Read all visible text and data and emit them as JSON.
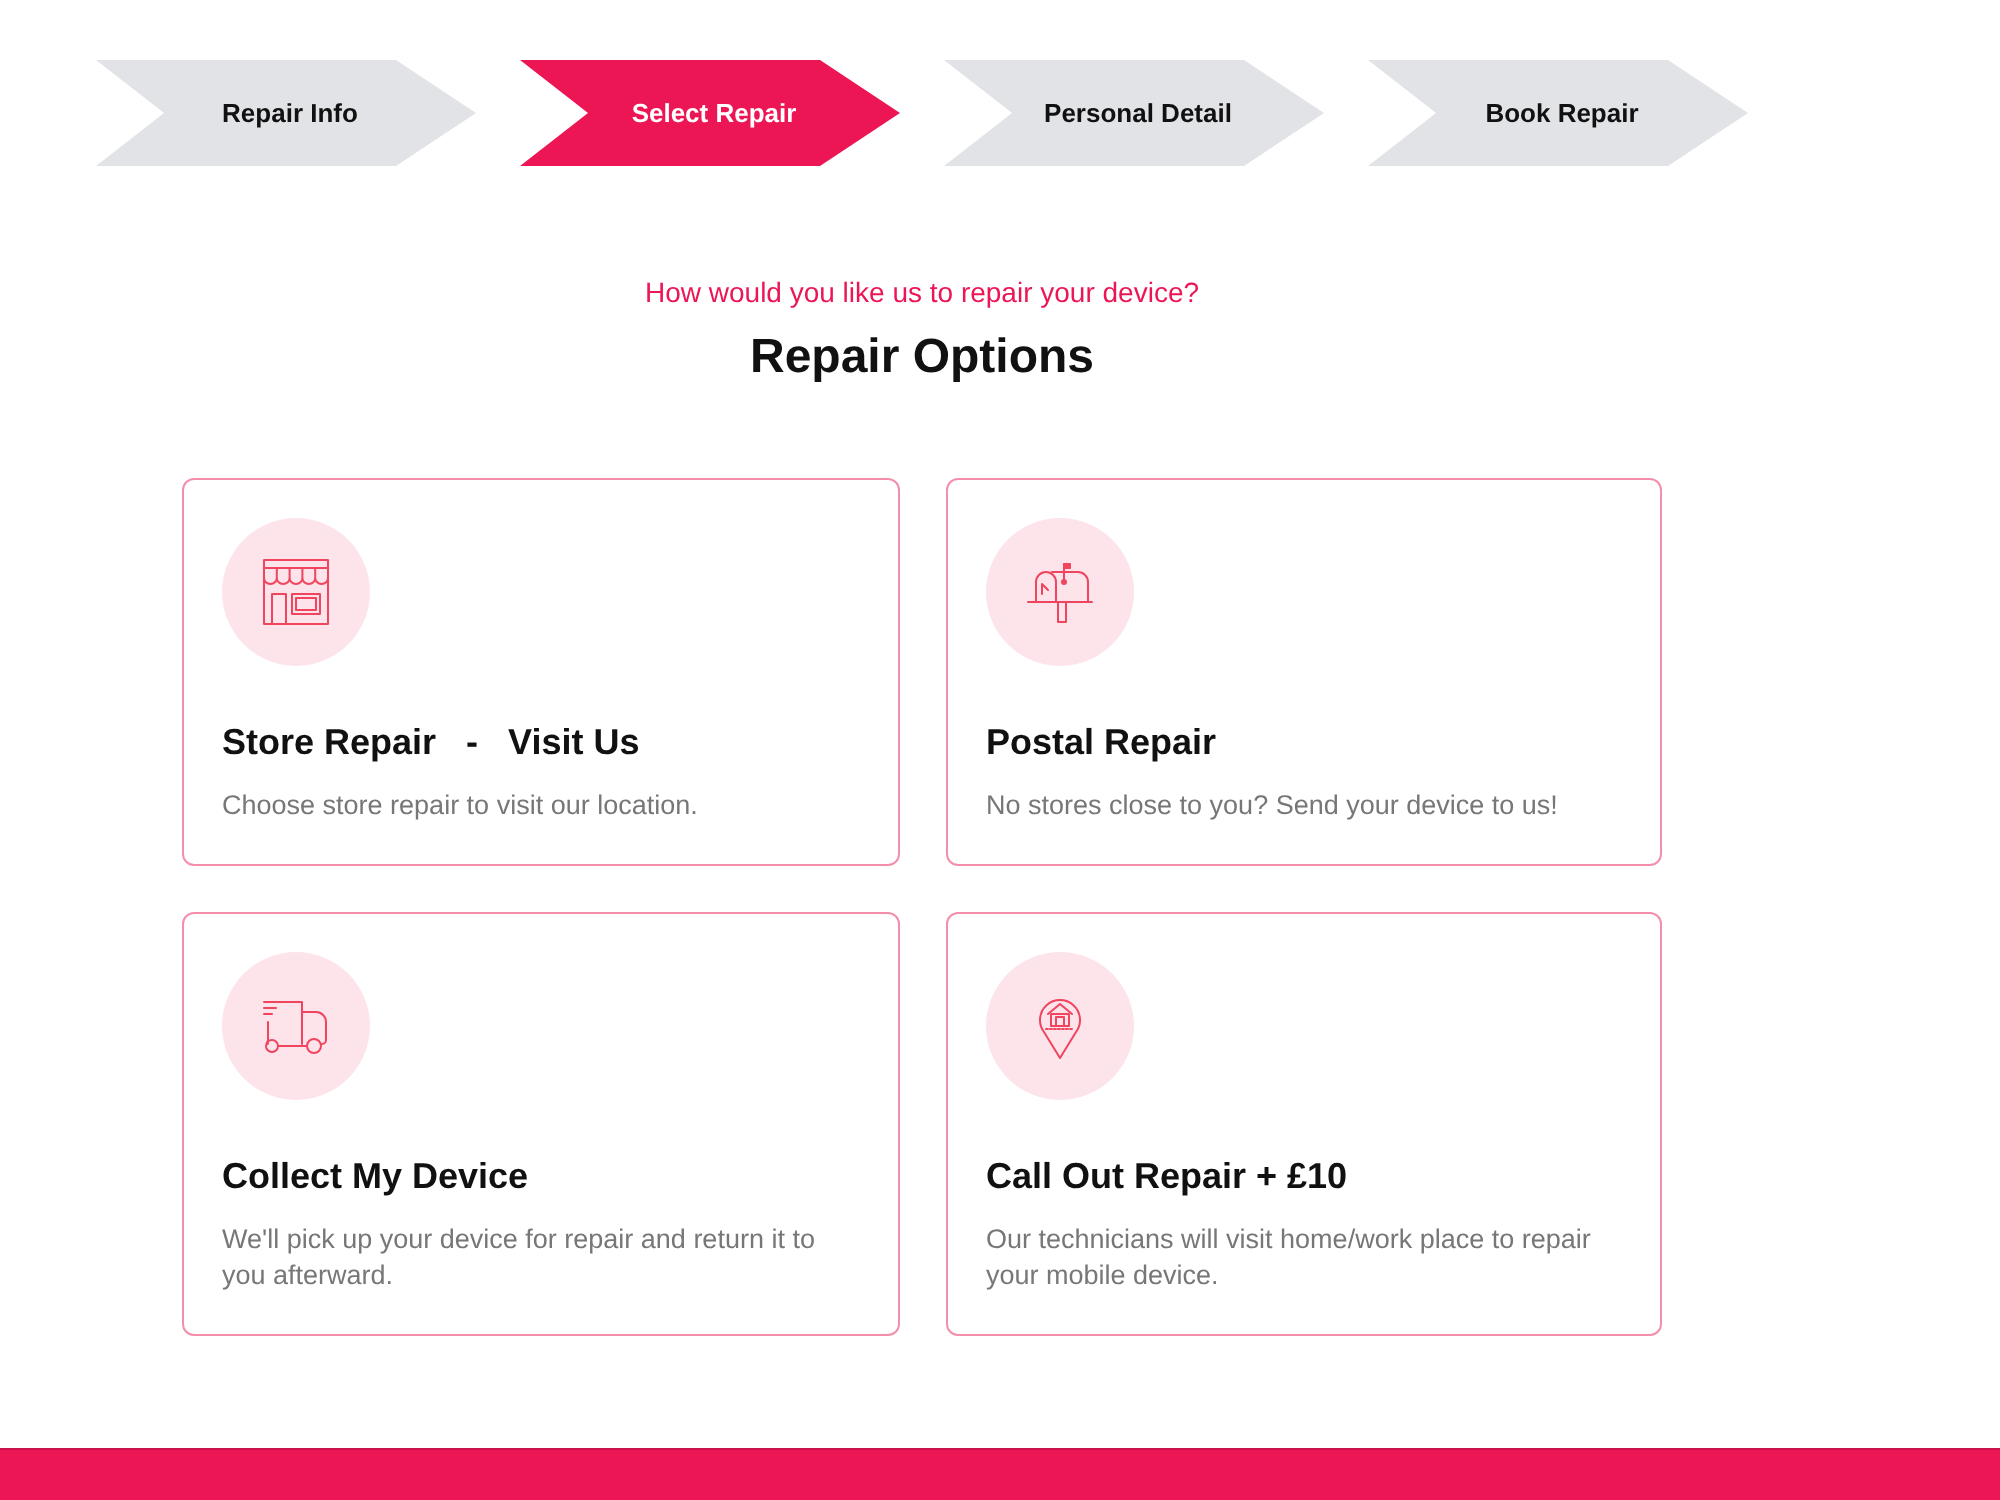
{
  "steps": [
    {
      "label": "Repair Info",
      "selected": false
    },
    {
      "label": "Select Repair",
      "selected": true
    },
    {
      "label": "Personal Detail",
      "selected": false
    },
    {
      "label": "Book Repair",
      "selected": false
    }
  ],
  "header": {
    "eyebrow": "How would you like us to repair your device?",
    "title": "Repair Options"
  },
  "options": [
    {
      "kind": "store",
      "title": "Store Repair   -   Visit Us",
      "description": "Choose store repair to visit our location."
    },
    {
      "kind": "postal",
      "title": "Postal Repair",
      "description": "No stores close to you? Send your device to us!"
    },
    {
      "kind": "collect",
      "title": "Collect My Device",
      "description": "We'll pick up your device for repair and return it to you afterward."
    },
    {
      "kind": "callout",
      "title": "Call Out Repair + £10",
      "description": "Our technicians will visit home/work place to repair your mobile device."
    }
  ]
}
